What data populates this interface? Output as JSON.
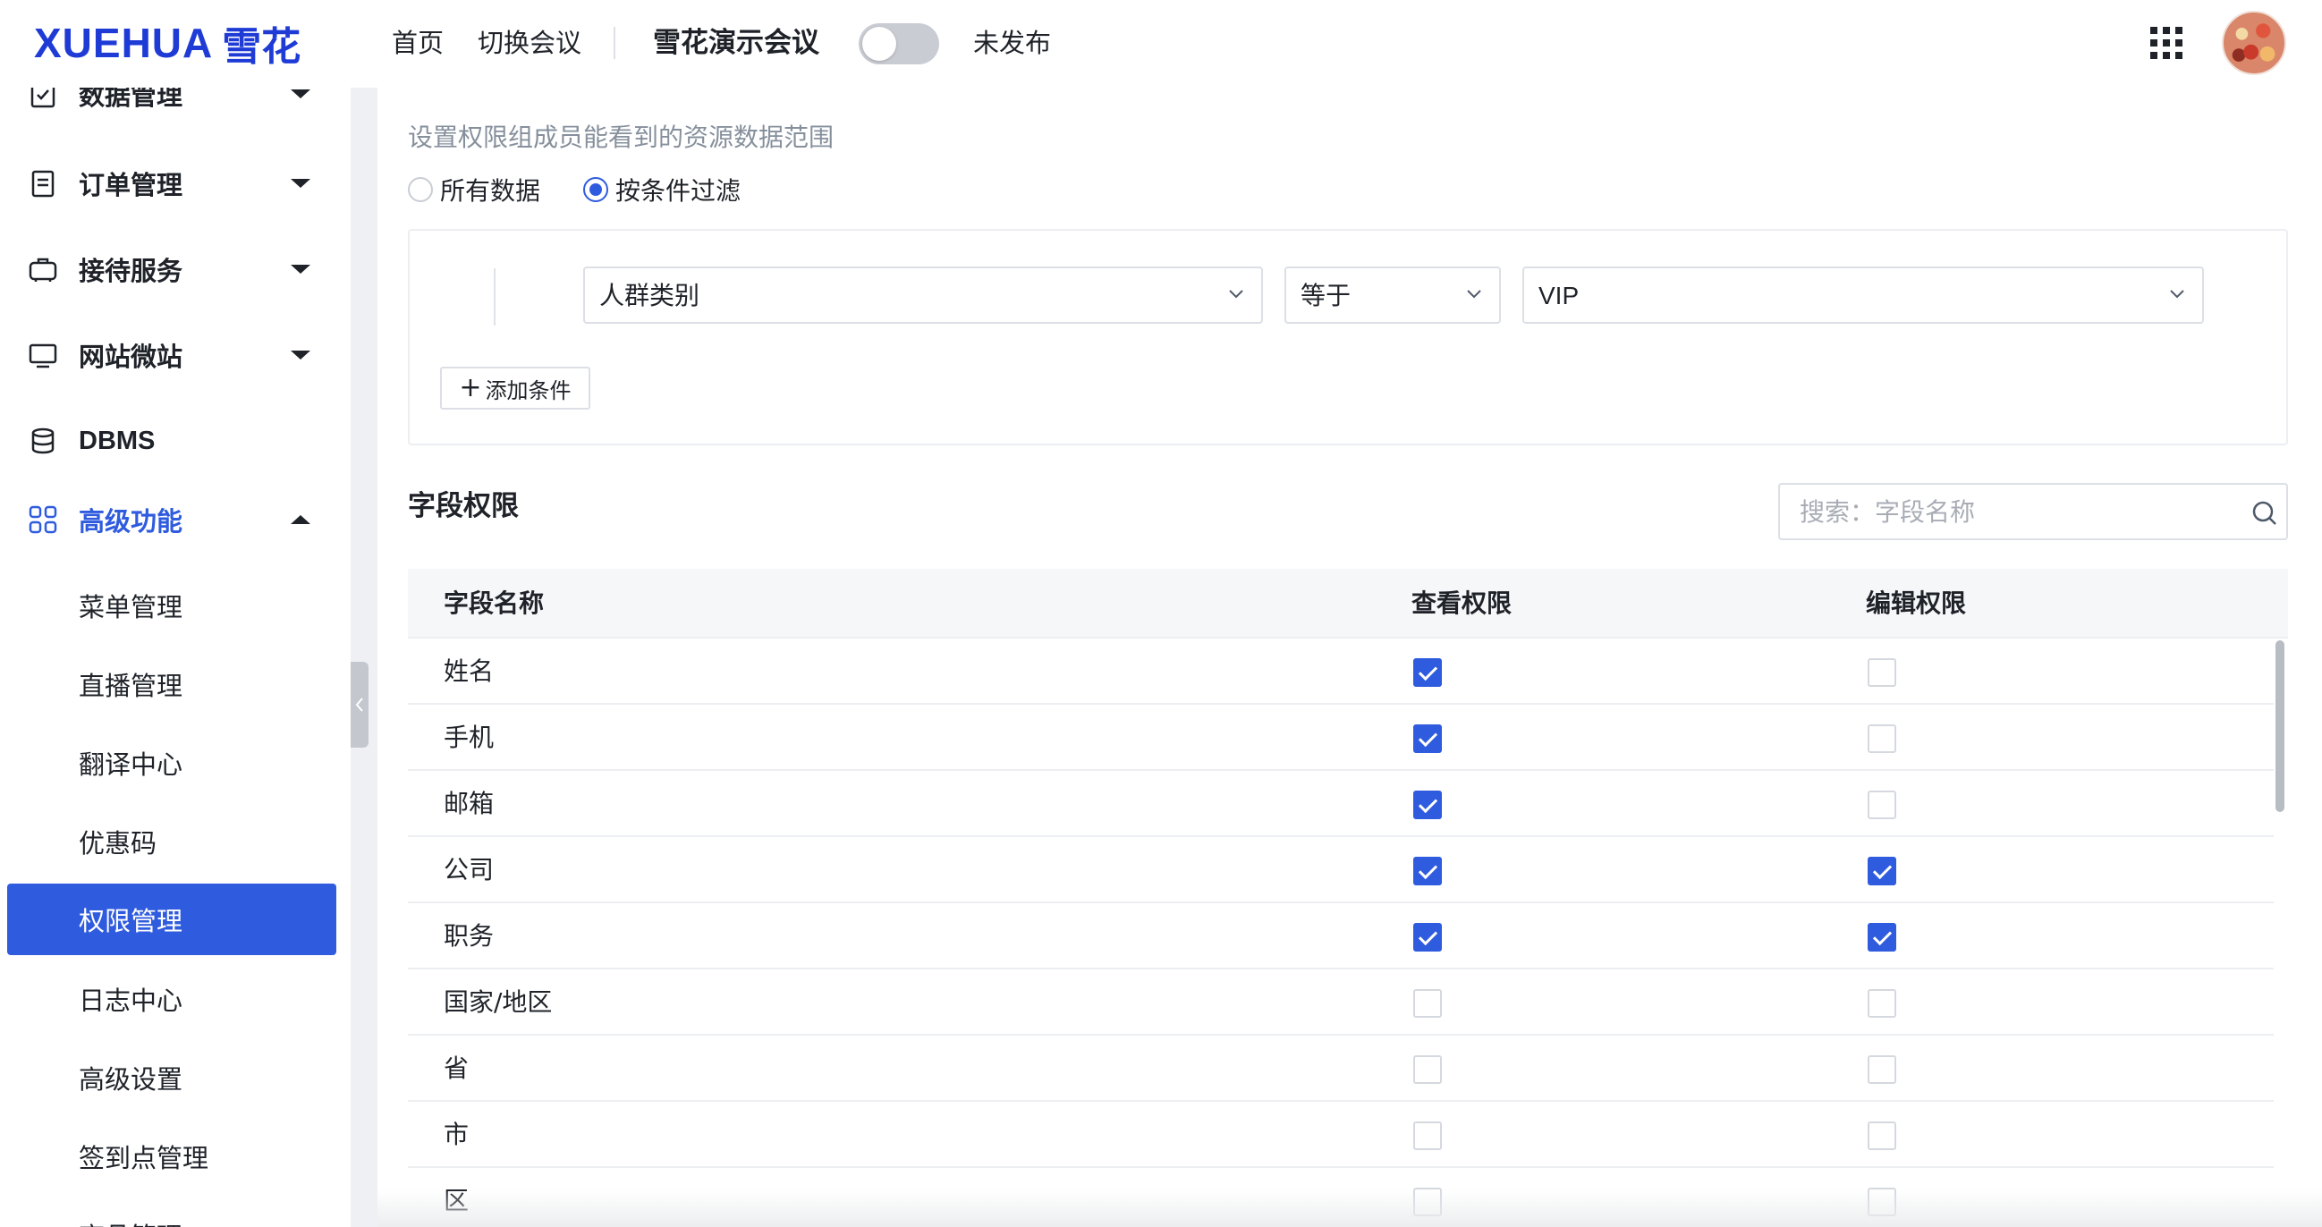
{
  "header": {
    "logo_latin": "XUEHUA",
    "logo_cjk": "雪花",
    "nav": [
      "首页",
      "切换会议"
    ],
    "meeting_name": "雪花演示会议",
    "publish_status": "未发布",
    "publish_toggle_on": false
  },
  "sidebar": {
    "items": [
      {
        "label": "数据管理",
        "icon": "checklist-icon",
        "expanded": false
      },
      {
        "label": "订单管理",
        "icon": "document-icon",
        "expanded": false
      },
      {
        "label": "接待服务",
        "icon": "luggage-icon",
        "expanded": false
      },
      {
        "label": "网站微站",
        "icon": "monitor-icon",
        "expanded": false
      },
      {
        "label": "DBMS",
        "icon": "database-icon"
      },
      {
        "label": "高级功能",
        "icon": "grid-icon",
        "expanded": true
      }
    ],
    "sub_items": [
      "菜单管理",
      "直播管理",
      "翻译中心",
      "优惠码",
      "权限管理",
      "日志中心",
      "高级设置",
      "签到点管理",
      "商品管理"
    ],
    "active_sub_item": "权限管理",
    "accent_color": "#2f5bde"
  },
  "scope": {
    "description": "设置权限组成员能看到的资源数据范围",
    "options": [
      {
        "label": "所有数据",
        "checked": false
      },
      {
        "label": "按条件过滤",
        "checked": true
      }
    ]
  },
  "filter": {
    "field": "人群类别",
    "operator": "等于",
    "value": "VIP",
    "add_condition_label": "添加条件"
  },
  "field_permissions": {
    "title": "字段权限",
    "search_placeholder": "搜索：字段名称",
    "columns": [
      "字段名称",
      "查看权限",
      "编辑权限"
    ],
    "rows": [
      {
        "name": "姓名",
        "view": true,
        "edit": false
      },
      {
        "name": "手机",
        "view": true,
        "edit": false
      },
      {
        "name": "邮箱",
        "view": true,
        "edit": false
      },
      {
        "name": "公司",
        "view": true,
        "edit": true
      },
      {
        "name": "职务",
        "view": true,
        "edit": true
      },
      {
        "name": "国家/地区",
        "view": false,
        "edit": false
      },
      {
        "name": "省",
        "view": false,
        "edit": false
      },
      {
        "name": "市",
        "view": false,
        "edit": false
      },
      {
        "name": "区",
        "view": false,
        "edit": false
      }
    ]
  }
}
